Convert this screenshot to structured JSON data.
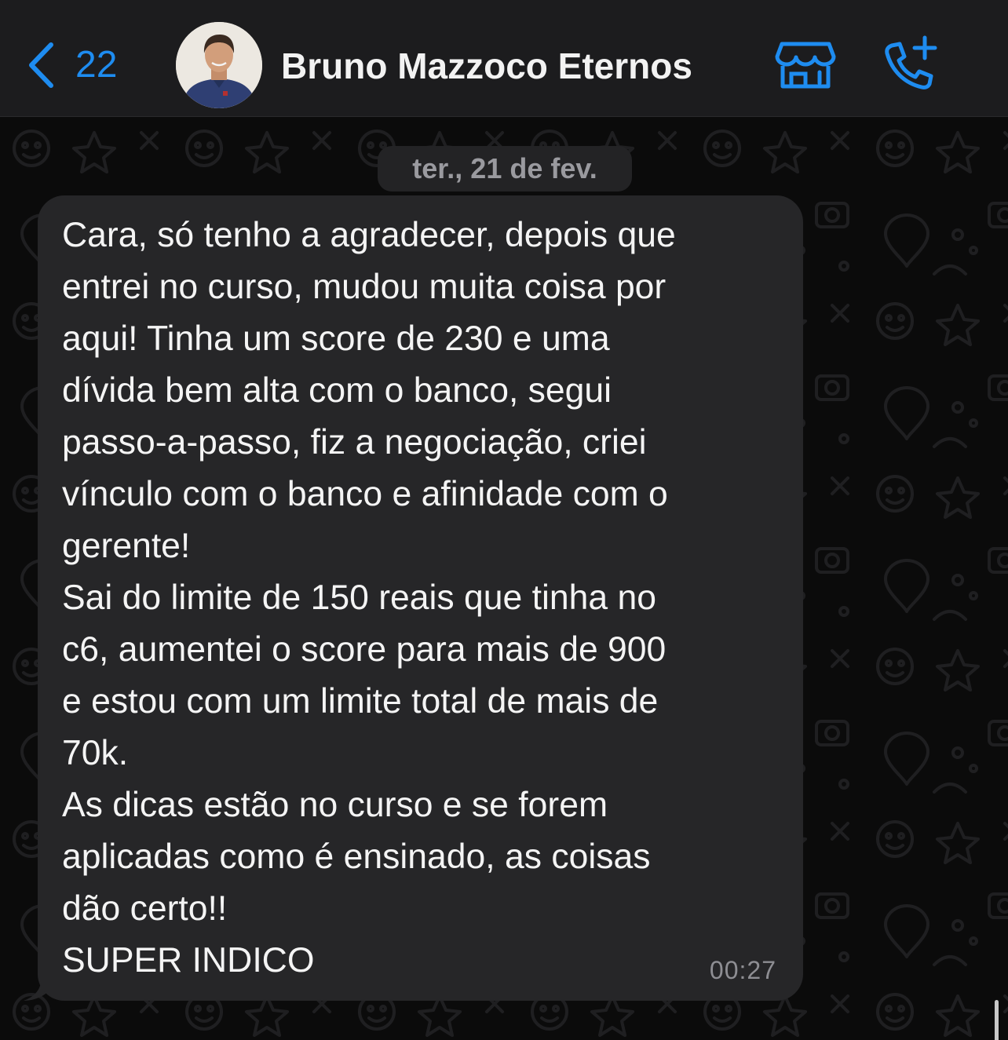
{
  "header": {
    "back_count": "22",
    "contact_name": "Bruno Mazzoco Eternos",
    "icons": {
      "back": "chevron-left-icon",
      "store": "storefront-icon",
      "call": "add-call-icon"
    },
    "accent_color": "#1e8cf0"
  },
  "chat": {
    "date_label": "ter., 21 de fev.",
    "message": {
      "lines": [
        "Cara, só tenho a agradecer, depois que",
        "entrei no curso, mudou muita coisa por",
        "aqui! Tinha um score de 230 e uma",
        "dívida bem alta com o banco, segui",
        "passo-a-passo, fiz a negociação, criei",
        "vínculo com o banco e afinidade com o",
        "gerente!",
        "Sai do limite de 150 reais que tinha no",
        "c6, aumentei o score para mais de 900",
        "e estou com um limite total de mais de",
        "70k.",
        "As dicas estão no curso e se forem",
        "aplicadas como é ensinado, as coisas",
        "dão certo!!",
        "SUPER INDICO"
      ],
      "time": "00:27",
      "direction": "incoming"
    }
  }
}
